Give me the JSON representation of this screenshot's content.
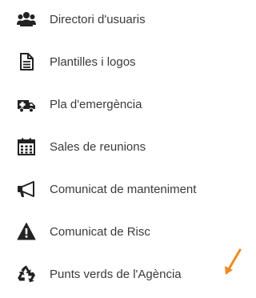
{
  "menu": {
    "items": [
      {
        "label": "Directori d'usuaris",
        "icon": "users-group-icon"
      },
      {
        "label": "Plantilles i logos",
        "icon": "document-icon"
      },
      {
        "label": "Pla d'emergència",
        "icon": "ambulance-icon"
      },
      {
        "label": "Sales de reunions",
        "icon": "calendar-icon"
      },
      {
        "label": "Comunicat de manteniment",
        "icon": "megaphone-icon"
      },
      {
        "label": "Comunicat de Risc",
        "icon": "warning-icon"
      },
      {
        "label": "Punts verds de l'Agència",
        "icon": "recycle-icon"
      }
    ]
  },
  "colors": {
    "icon": "#222222",
    "text": "#3a3a3a",
    "arrow": "#f08a24",
    "background": "#ffffff"
  },
  "annotation": {
    "arrow_icon": "pointer-arrow-icon"
  }
}
